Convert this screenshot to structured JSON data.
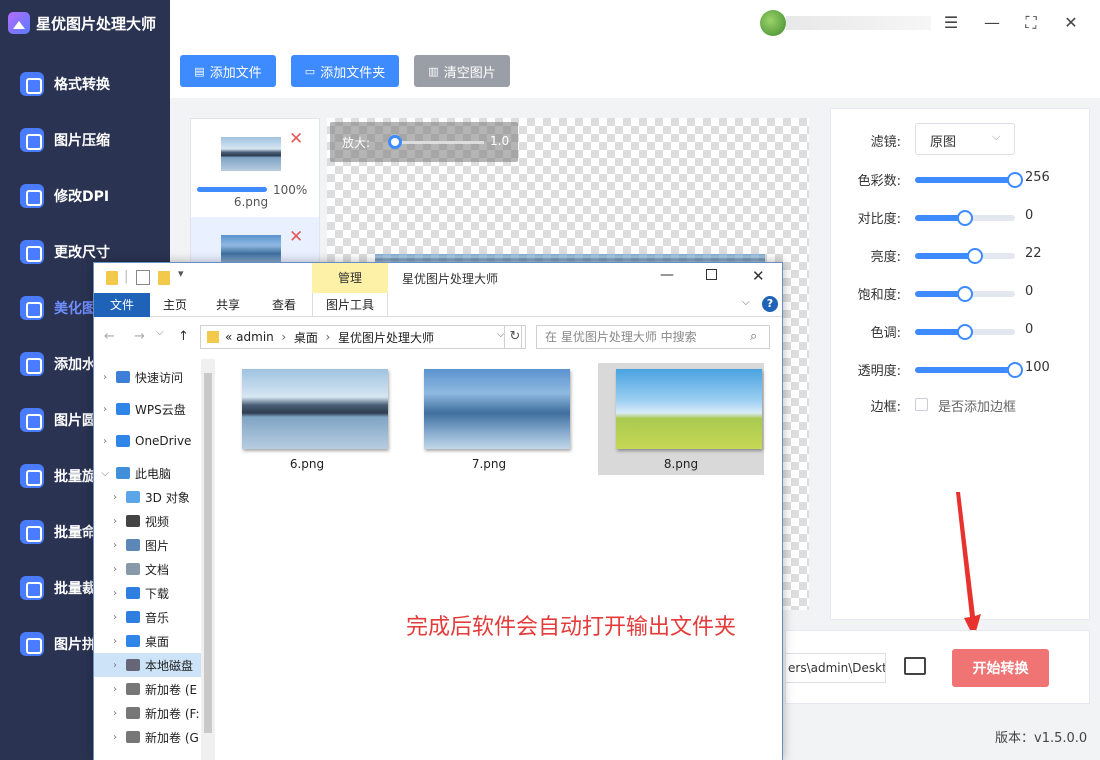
{
  "app": {
    "title": "星优图片处理大师",
    "version": "版本：v1.5.0.0"
  },
  "sidebar": {
    "items": [
      {
        "label": "格式转换"
      },
      {
        "label": "图片压缩"
      },
      {
        "label": "修改DPI"
      },
      {
        "label": "更改尺寸"
      },
      {
        "label": "美化图"
      },
      {
        "label": "添加水"
      },
      {
        "label": "图片圆"
      },
      {
        "label": "批量旋"
      },
      {
        "label": "批量命"
      },
      {
        "label": "批量裁"
      },
      {
        "label": "图片拼"
      }
    ],
    "active_index": 4,
    "active_color": "#6f8dff"
  },
  "toolbar": {
    "add_file": "添加文件",
    "add_folder": "添加文件夹",
    "clear": "清空图片",
    "primary_color": "#3d8bff"
  },
  "thumbs": [
    {
      "name": "6.png",
      "progress": "100%",
      "progress_value": 1.0
    }
  ],
  "canvas": {
    "zoom_label": "放大:",
    "zoom_value": "1.0"
  },
  "panel": {
    "filter_label": "滤镜:",
    "filter_value": "原图",
    "sliders": [
      {
        "label": "色彩数:",
        "value": "256",
        "level": 1.0
      },
      {
        "label": "对比度:",
        "value": "0",
        "level": 0.5
      },
      {
        "label": "亮度:",
        "value": "22",
        "level": 0.6
      },
      {
        "label": "饱和度:",
        "value": "0",
        "level": 0.5
      },
      {
        "label": "色调:",
        "value": "0",
        "level": 0.5
      },
      {
        "label": "透明度:",
        "value": "100",
        "level": 1.0
      }
    ],
    "border_label": "边框:",
    "border_checkbox_label": "是否添加边框"
  },
  "output": {
    "path": "ers\\admin\\Deskto",
    "start_label": "开始转换",
    "start_color": "#f07474"
  },
  "explorer": {
    "title": "星优图片处理大师",
    "manage_tab": "管理",
    "picture_tools": "图片工具",
    "tabs": [
      "文件",
      "主页",
      "共享",
      "查看"
    ],
    "path": [
      "«",
      "admin",
      "›",
      "桌面",
      "›",
      "星优图片处理大师"
    ],
    "search_placeholder": "在 星优图片处理大师 中搜索",
    "nav": [
      {
        "label": "快速访问",
        "icon": "star-icon"
      },
      {
        "label": "WPS云盘",
        "icon": "cloud-icon"
      },
      {
        "label": "OneDrive",
        "icon": "cloud-icon"
      },
      {
        "label": "此电脑",
        "icon": "computer-icon"
      },
      {
        "label": "3D 对象",
        "icon": "cube-icon"
      },
      {
        "label": "视频",
        "icon": "video-icon"
      },
      {
        "label": "图片",
        "icon": "picture-icon"
      },
      {
        "label": "文档",
        "icon": "document-icon"
      },
      {
        "label": "下载",
        "icon": "download-icon"
      },
      {
        "label": "音乐",
        "icon": "music-icon"
      },
      {
        "label": "桌面",
        "icon": "desktop-icon"
      },
      {
        "label": "本地磁盘",
        "icon": "disk-icon"
      },
      {
        "label": "新加卷 (E",
        "icon": "drive-icon"
      },
      {
        "label": "新加卷 (F:",
        "icon": "drive-icon"
      },
      {
        "label": "新加卷 (G",
        "icon": "drive-icon"
      }
    ],
    "files": [
      {
        "name": "6.png"
      },
      {
        "name": "7.png"
      },
      {
        "name": "8.png"
      }
    ],
    "selected_file": "8.png"
  },
  "annotation": "完成后软件会自动打开输出文件夹"
}
